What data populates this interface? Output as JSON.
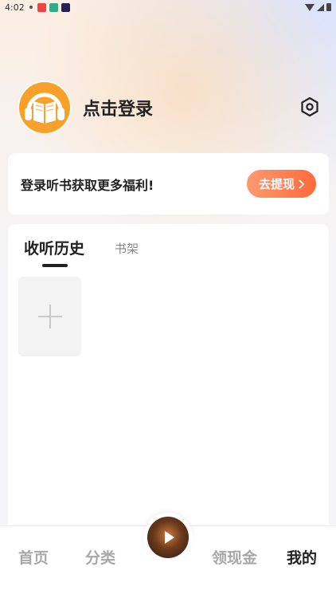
{
  "status_bar": {
    "time": "4:02"
  },
  "profile": {
    "login_label": "点击登录"
  },
  "promo": {
    "text": "登录听书获取更多福利!",
    "button_label": "去提现"
  },
  "history": {
    "tabs": [
      {
        "label": "收听历史",
        "active": true
      },
      {
        "label": "书架",
        "active": false
      }
    ]
  },
  "bottom_nav": {
    "items": [
      {
        "label": "首页",
        "active": false
      },
      {
        "label": "分类",
        "active": false
      },
      {
        "label": "领现金",
        "active": false
      },
      {
        "label": "我的",
        "active": true
      }
    ]
  },
  "colors": {
    "accent_orange": "#f7a02a",
    "button_gradient_start": "#ff9a6e",
    "button_gradient_end": "#ff6a3c"
  },
  "icons": {
    "avatar": "headphone-book-icon",
    "settings": "hexagon-settings-icon",
    "add": "plus-icon",
    "play": "play-icon"
  }
}
